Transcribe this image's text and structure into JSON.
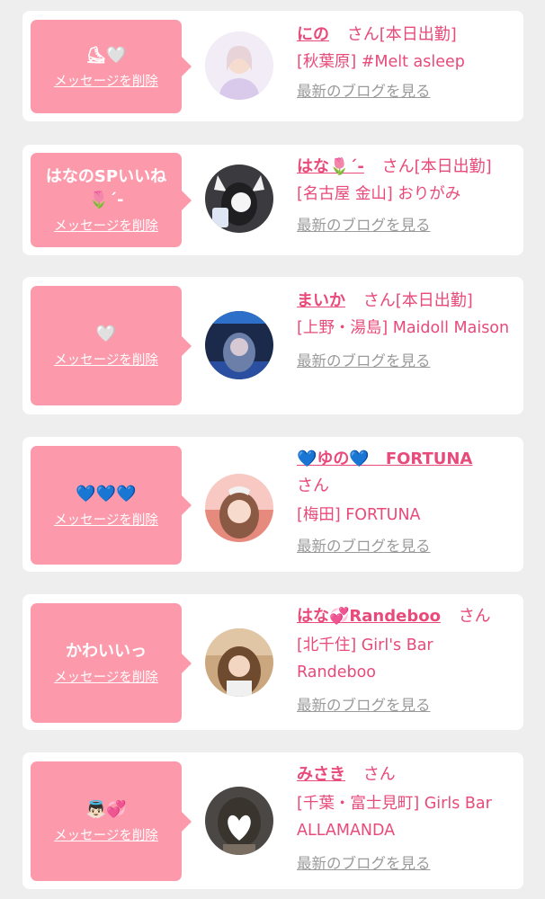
{
  "cards": [
    {
      "message": "⛸🤍",
      "delete_label": "メッセージを削除",
      "name": "にの",
      "honorific": "さん",
      "status": "[本日出勤]",
      "shop": "[秋葉原] #Melt asleep",
      "blog_label": "最新のブログを見る"
    },
    {
      "message": "はなのSPいいね\n🌷´-",
      "delete_label": "メッセージを削除",
      "name": "はな🌷´-",
      "honorific": "さん",
      "status": "[本日出勤]",
      "shop": "[名古屋 金山] おりがみ",
      "blog_label": "最新のブログを見る"
    },
    {
      "message": "🤍",
      "delete_label": "メッセージを削除",
      "name": "まいか",
      "honorific": "さん",
      "status": "[本日出勤]",
      "shop": "[上野・湯島] Maidoll Maison",
      "blog_label": "最新のブログを見る"
    },
    {
      "message": "💙💙💙",
      "delete_label": "メッセージを削除",
      "name": "💙ゆの💙　FORTUNA",
      "honorific": "さん",
      "status": "",
      "shop": "[梅田] FORTUNA",
      "blog_label": "最新のブログを見る"
    },
    {
      "message": "かわいいっ",
      "delete_label": "メッセージを削除",
      "name": "はな💞Randeboo",
      "honorific": "さん",
      "status": "",
      "shop": "[北千住] Girl's Bar Randeboo",
      "blog_label": "最新のブログを見る"
    },
    {
      "message": "👼🏻💞",
      "delete_label": "メッセージを削除",
      "name": "みさき",
      "honorific": "さん",
      "status": "",
      "shop": "[千葉・富士見町] Girls Bar ALLAMANDA",
      "blog_label": "最新のブログを見る"
    }
  ],
  "colors": {
    "bubble": "#fc9aac",
    "accent": "#e84a7a",
    "link_gray": "#9a9a9a",
    "background": "#eeeeee"
  }
}
